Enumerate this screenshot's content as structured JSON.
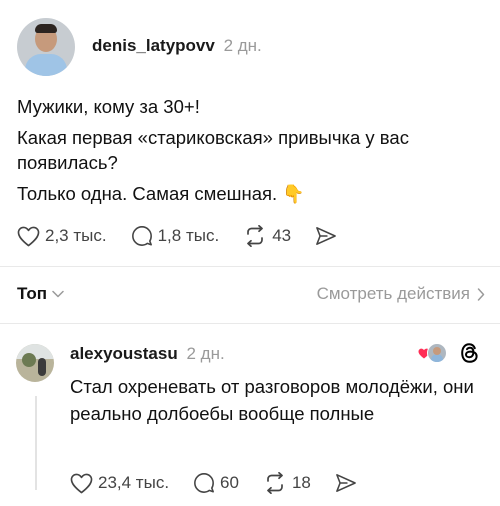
{
  "post": {
    "author": "denis_latypovv",
    "time": "2 дн.",
    "lines": [
      "Мужики, кому за 30+!",
      "Какая первая «стариковская» привычка у вас появилась?",
      "Только одна. Самая смешная."
    ],
    "emoji": "👇",
    "likes": "2,3 тыс.",
    "replies": "1,8 тыс.",
    "reposts": "43"
  },
  "sort": {
    "label": "Топ",
    "view_activity": "Смотреть действия"
  },
  "comment": {
    "author": "alexyoustasu",
    "time": "2 дн.",
    "text": "Стал охреневать  от разговоров молодёжи, они реально долбоебы вообще полные",
    "likes": "23,4 тыс.",
    "replies": "60",
    "reposts": "18"
  },
  "icons": {
    "like": "heart-icon",
    "reply": "comment-bubble-icon",
    "repost": "repost-icon",
    "share": "share-send-icon",
    "threads": "threads-logo-icon"
  },
  "colors": {
    "liked_heart": "#ff2d55",
    "muted_text": "#9a9a9a",
    "action_icon": "#444444"
  }
}
